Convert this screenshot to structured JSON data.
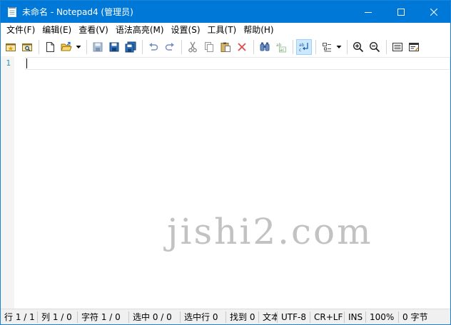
{
  "window": {
    "title": "未命名 - Notepad4 (管理员)"
  },
  "menu": [
    "文件(F)",
    "编辑(E)",
    "查看(V)",
    "语法高亮(M)",
    "设置(S)",
    "工具(T)",
    "帮助(H)"
  ],
  "editor": {
    "line_numbers": [
      "1"
    ],
    "watermark": "jishi2.com"
  },
  "status": {
    "line": "行 1 / 1",
    "column": "列 1 / 0",
    "char": "字符 1 / 0",
    "selection": "选中 0 / 0",
    "selected_lines": "选中行 0",
    "find": "找到 0",
    "file_type": "文本",
    "encoding": "UTF-8",
    "eol": "CR+LF",
    "ins": "INS",
    "zoom": "100%",
    "bytes": "0 字节"
  },
  "colors": {
    "titlebar": "#0078d7",
    "line_number": "#2b91af",
    "gutter": "#f4f4f4",
    "statusbar": "#f0f0f0"
  },
  "toolbar_icons": [
    "new-from-template-icon",
    "browse-icon",
    "new-file-icon",
    "open-file-icon",
    "save-icon",
    "save-as-icon",
    "save-all-icon",
    "undo-icon",
    "redo-icon",
    "cut-icon",
    "copy-icon",
    "paste-icon",
    "delete-icon",
    "find-icon",
    "replace-icon",
    "word-wrap-icon",
    "view-options-icon",
    "zoom-in-icon",
    "zoom-out-icon",
    "settings-icon",
    "about-icon"
  ]
}
